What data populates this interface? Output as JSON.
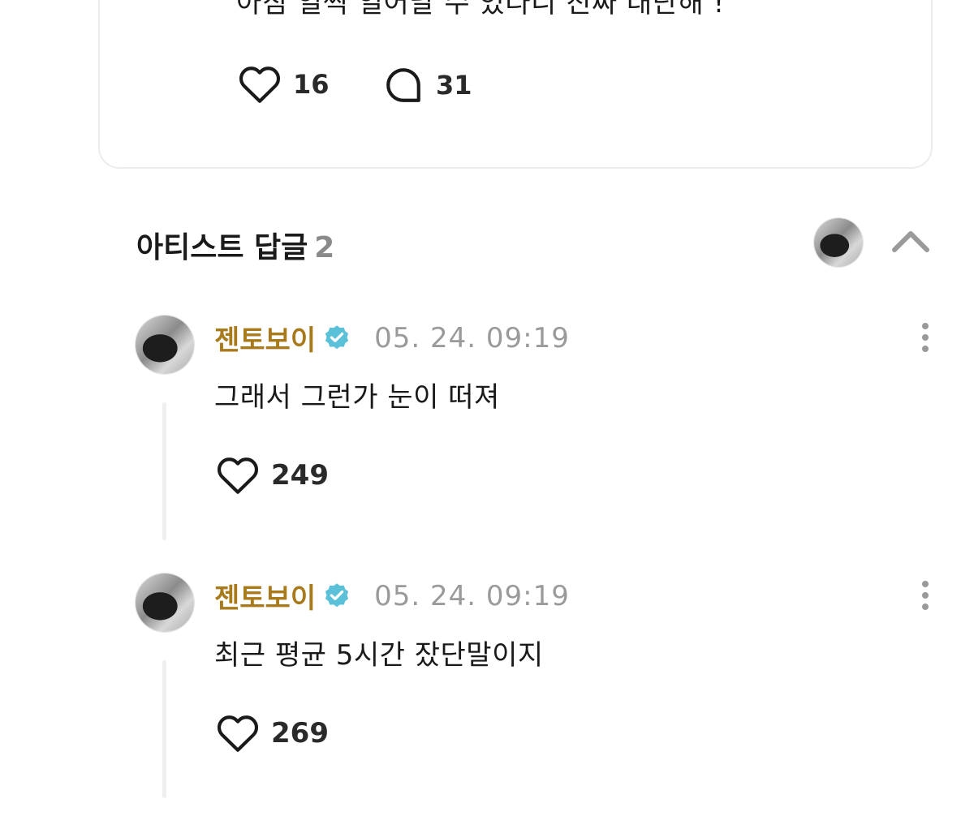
{
  "post": {
    "text": "아침 일찍 일어날 수 있다니 진짜 대단해 !",
    "likes": "16",
    "comments": "31"
  },
  "artist_replies": {
    "title": "아티스트 답글",
    "count": "2"
  },
  "replies": [
    {
      "author": "젠토보이",
      "time": "05. 24. 09:19",
      "text": "그래서 그런가 눈이 떠져",
      "likes": "249"
    },
    {
      "author": "젠토보이",
      "time": "05. 24. 09:19",
      "text": "최근 평균 5시간 잤단말이지",
      "likes": "269"
    }
  ],
  "colors": {
    "author": "#a97a1c",
    "verified": "#5bc1d8",
    "muted": "#9a9a9a"
  },
  "icons": [
    "heart-icon",
    "comment-icon",
    "chevron-up-icon",
    "verified-icon",
    "more-vertical-icon"
  ]
}
